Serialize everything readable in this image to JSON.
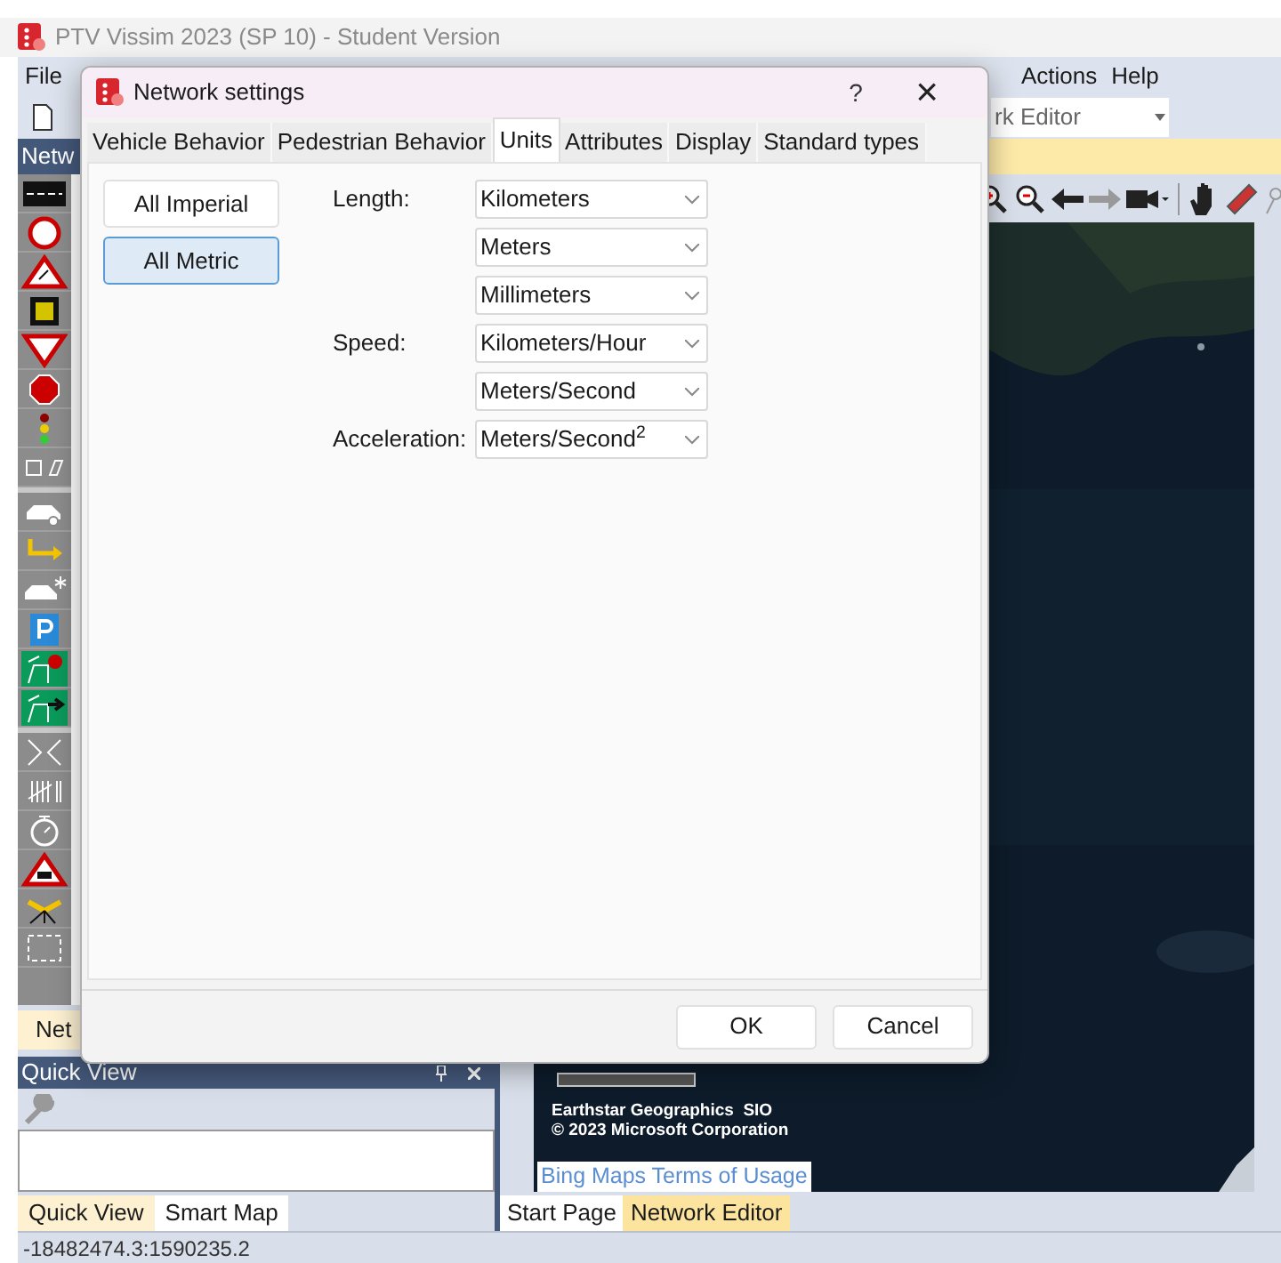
{
  "window": {
    "title": "PTV Vissim 2023 (SP 10) - Student Version"
  },
  "menu": [
    "File",
    "Actions",
    "Help"
  ],
  "view_combo": {
    "value": "rk Editor"
  },
  "network_panel": {
    "header": "Netw",
    "tab": "Net"
  },
  "quick_view": {
    "title": "Quick View"
  },
  "left_tabs": [
    {
      "label": "Quick View",
      "selected": true
    },
    {
      "label": "Smart Map",
      "selected": false
    }
  ],
  "map": {
    "attribution": [
      "Earthstar Geographics  SIO",
      "© 2023 Microsoft Corporation"
    ],
    "terms_link": "Bing Maps Terms of Usage"
  },
  "editor_tabs": [
    {
      "label": "Start Page",
      "selected": false
    },
    {
      "label": "Network Editor",
      "selected": true
    }
  ],
  "status_bar": "-18482474.3:1590235.2",
  "dialog": {
    "title": "Network settings",
    "help": "?",
    "close": "×",
    "tabs": [
      {
        "label": "Vehicle Behavior",
        "selected": false
      },
      {
        "label": "Pedestrian Behavior",
        "selected": false
      },
      {
        "label": "Units",
        "selected": true
      },
      {
        "label": "Attributes",
        "selected": false
      },
      {
        "label": "Display",
        "selected": false
      },
      {
        "label": "Standard types",
        "selected": false
      }
    ],
    "presets": [
      {
        "label": "All Imperial",
        "selected": false
      },
      {
        "label": "All Metric",
        "selected": true
      }
    ],
    "units": [
      {
        "label": "Length:",
        "value": "Kilometers"
      },
      {
        "value": "Meters"
      },
      {
        "value": "Millimeters"
      },
      {
        "label": "Speed:",
        "value": "Kilometers/Hour"
      },
      {
        "value": "Meters/Second"
      },
      {
        "label": "Acceleration:",
        "value": "Meters/Second$^{2}$"
      }
    ],
    "buttons": [
      "OK",
      "Cancel"
    ]
  }
}
